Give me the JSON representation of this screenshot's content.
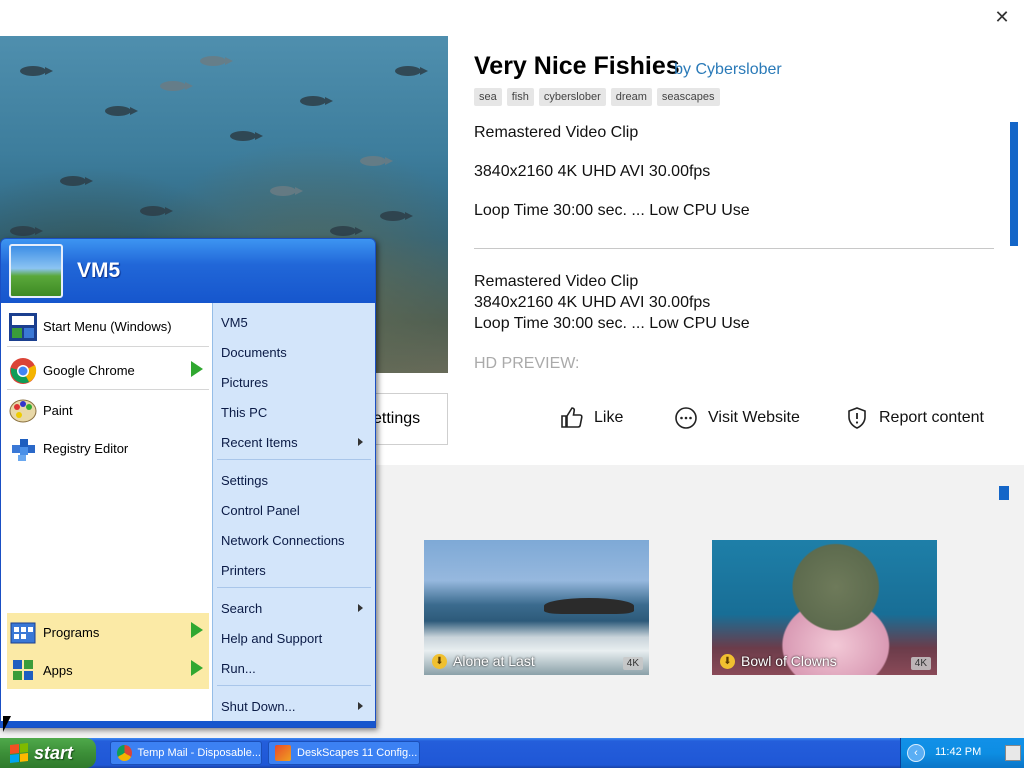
{
  "window": {
    "close_glyph": "✕"
  },
  "wallpaper": {
    "title": "Very Nice Fishies",
    "author": "by Cyberslober",
    "tags": [
      "sea",
      "fish",
      "cyberslober",
      "dream",
      "seascapes"
    ],
    "description_lines": [
      "Remastered Video Clip",
      "3840x2160 4K UHD AVI 30.00fps",
      "Loop Time 30:00 sec. ... Low CPU Use"
    ],
    "description_block": [
      "Remastered Video Clip",
      "3840x2160 4K UHD AVI 30.00fps",
      "Loop Time 30:00 sec. ... Low CPU Use"
    ],
    "hd_preview_label": "HD PREVIEW:"
  },
  "actions": {
    "settings_label": "ettings",
    "like_label": "Like",
    "visit_label": "Visit Website",
    "report_label": "Report content"
  },
  "gallery": [
    {
      "caption": "Alone at Last",
      "badge": "4K"
    },
    {
      "caption": "Bowl of Clowns",
      "badge": "4K"
    }
  ],
  "start_menu": {
    "user": "VM5",
    "pinned": [
      {
        "label": "Start Menu (Windows)",
        "icon": "start-menu-app-icon"
      },
      {
        "label": "Google Chrome",
        "icon": "chrome-icon"
      }
    ],
    "recent": [
      {
        "label": "Paint",
        "icon": "paint-icon"
      },
      {
        "label": "Registry Editor",
        "icon": "registry-icon"
      }
    ],
    "bottom": [
      {
        "label": "Programs",
        "icon": "programs-icon"
      },
      {
        "label": "Apps",
        "icon": "apps-icon"
      }
    ],
    "search_placeholder": "Search",
    "right_items": [
      "VM5",
      "Documents",
      "Pictures",
      "This PC",
      "Recent Items",
      "Settings",
      "Control Panel",
      "Network Connections",
      "Printers",
      "Search",
      "Help and Support",
      "Run...",
      "Shut Down..."
    ]
  },
  "taskbar": {
    "start_label": "start",
    "tasks": [
      {
        "label": "Temp Mail - Disposable...",
        "icon": "chrome-icon"
      },
      {
        "label": "DeskScapes 11 Config...",
        "icon": "deskscapes-icon"
      }
    ],
    "clock": "11:42 PM"
  },
  "colors": {
    "accent": "#1466c8",
    "xp_blue": "#245edb",
    "xp_green": "#3c8f38",
    "link": "#2a7ab8"
  }
}
